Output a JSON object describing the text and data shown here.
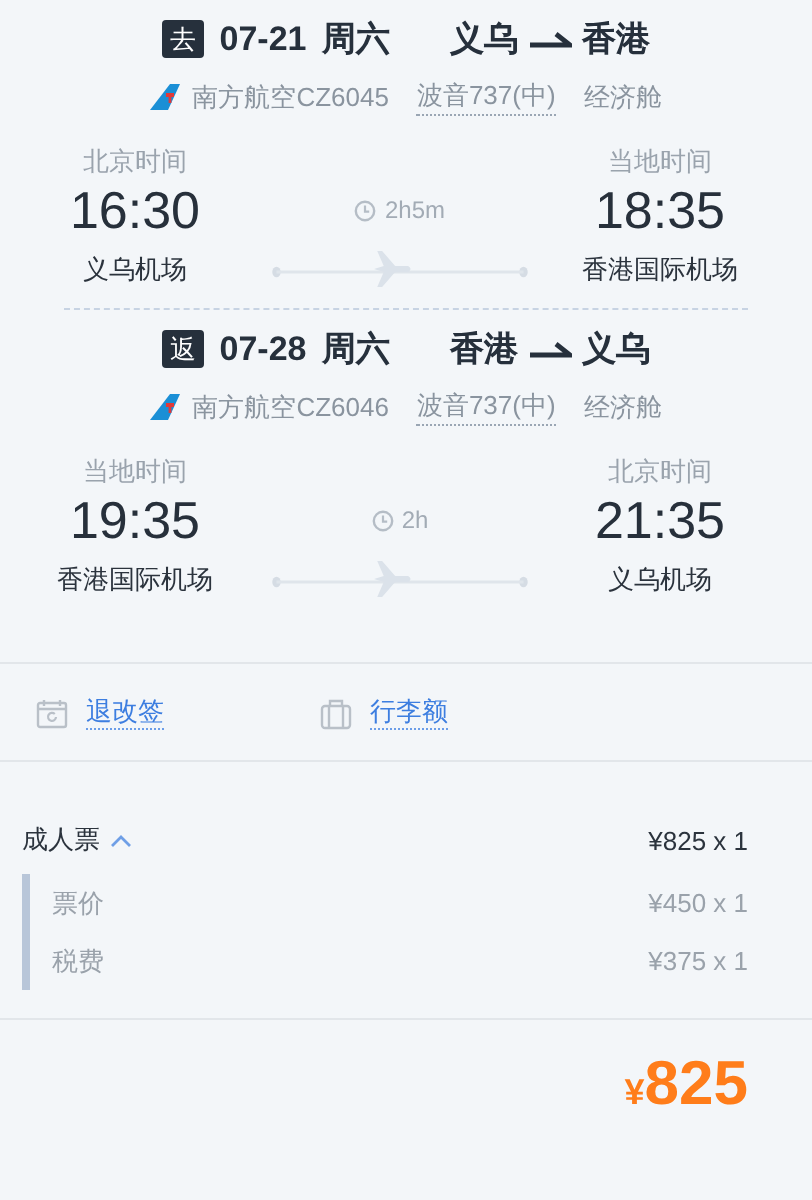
{
  "segments": [
    {
      "badge": "去",
      "date": "07-21",
      "weekday": "周六",
      "from_city": "义乌",
      "to_city": "香港",
      "airline": "南方航空CZ6045",
      "aircraft": "波音737(中)",
      "cabin": "经济舱",
      "departure": {
        "zone": "北京时间",
        "time": "16:30",
        "airport": "义乌机场"
      },
      "duration": "2h5m",
      "arrival": {
        "zone": "当地时间",
        "time": "18:35",
        "airport": "香港国际机场"
      }
    },
    {
      "badge": "返",
      "date": "07-28",
      "weekday": "周六",
      "from_city": "香港",
      "to_city": "义乌",
      "airline": "南方航空CZ6046",
      "aircraft": "波音737(中)",
      "cabin": "经济舱",
      "departure": {
        "zone": "当地时间",
        "time": "19:35",
        "airport": "香港国际机场"
      },
      "duration": "2h",
      "arrival": {
        "zone": "北京时间",
        "time": "21:35",
        "airport": "义乌机场"
      }
    }
  ],
  "links": [
    {
      "kind": "refund",
      "label": "退改签"
    },
    {
      "kind": "baggage",
      "label": "行李额"
    }
  ],
  "fares": [
    {
      "label": "成人票",
      "amount": "¥825 x 1",
      "expanded": true,
      "children": [
        {
          "label": "票价",
          "amount": "¥450 x 1"
        },
        {
          "label": "税费",
          "amount": "¥375 x 1"
        }
      ]
    }
  ],
  "total": {
    "currency": "¥",
    "amount": "825"
  }
}
